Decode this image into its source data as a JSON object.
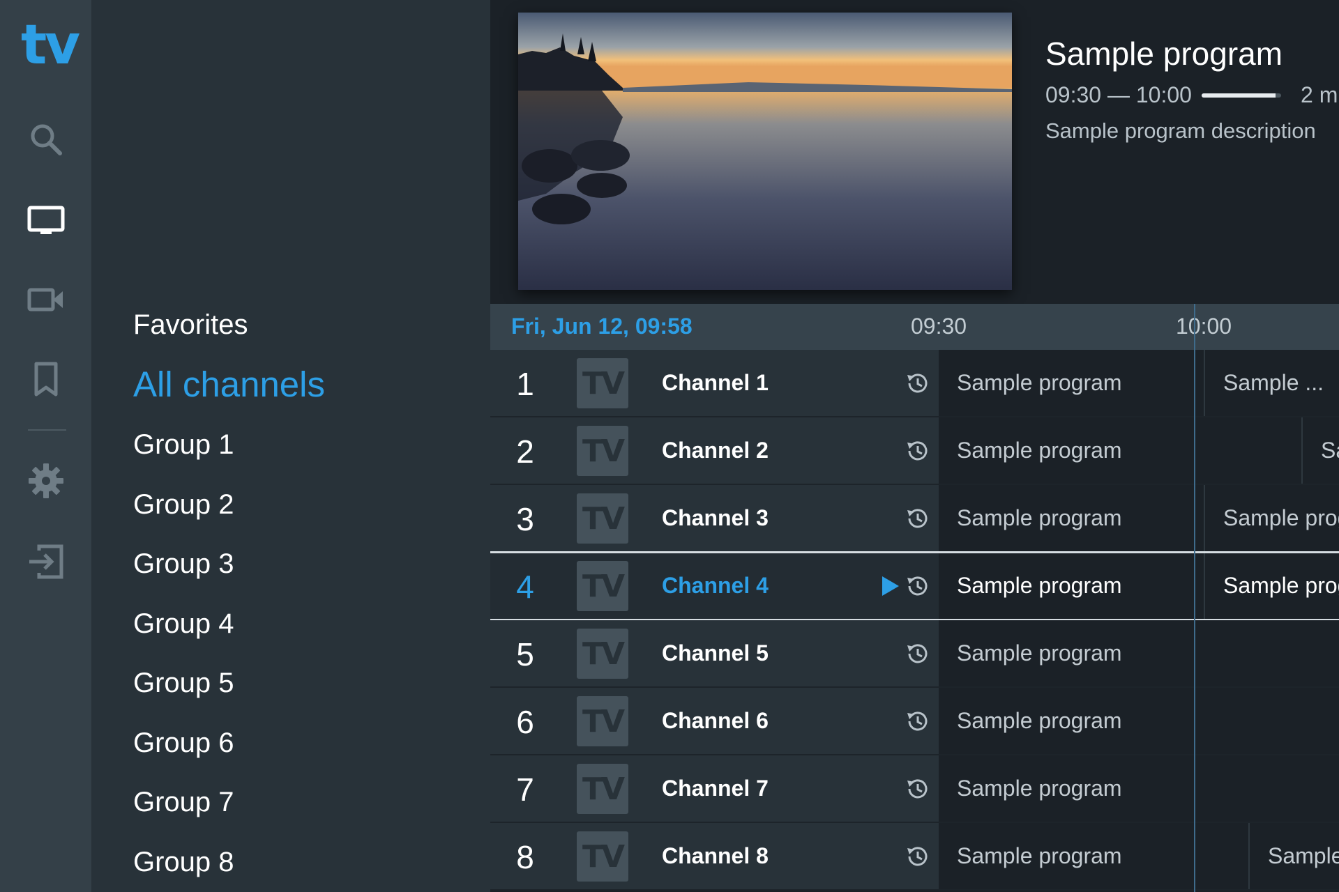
{
  "app": {
    "logo_text": "tv",
    "accent_color": "#2d9fe6"
  },
  "rail": {
    "icons": [
      "search-icon",
      "tv-icon",
      "video-camera-icon",
      "bookmark-icon",
      "settings-icon",
      "logout-icon"
    ]
  },
  "groups": {
    "items": [
      "Favorites",
      "All channels",
      "Group 1",
      "Group 2",
      "Group 3",
      "Group 4",
      "Group 5",
      "Group 6",
      "Group 7",
      "Group 8"
    ],
    "selected": "All channels"
  },
  "preview": {
    "title": "Sample program",
    "time_range": "09:30 — 10:00",
    "progress": 0.93,
    "remaining": "2 m",
    "description": "Sample program description"
  },
  "timeline": {
    "date": "Fri, Jun 12, 09:58",
    "ticks": [
      "09:30",
      "10:00"
    ]
  },
  "channels": [
    {
      "number": "1",
      "logo": "TV",
      "name": "Channel 1",
      "programs": [
        "Sample program",
        "Sample ..."
      ]
    },
    {
      "number": "2",
      "logo": "TV",
      "name": "Channel 2",
      "programs": [
        "Sample program",
        "Sa"
      ]
    },
    {
      "number": "3",
      "logo": "TV",
      "name": "Channel 3",
      "programs": [
        "Sample program",
        "Sample prog"
      ]
    },
    {
      "number": "4",
      "logo": "TV",
      "name": "Channel 4",
      "programs": [
        "Sample program",
        "Sample prog"
      ],
      "selected": true,
      "playing": true
    },
    {
      "number": "5",
      "logo": "TV",
      "name": "Channel 5",
      "programs": [
        "Sample program"
      ]
    },
    {
      "number": "6",
      "logo": "TV",
      "name": "Channel 6",
      "programs": [
        "Sample program"
      ]
    },
    {
      "number": "7",
      "logo": "TV",
      "name": "Channel 7",
      "programs": [
        "Sample program"
      ]
    },
    {
      "number": "8",
      "logo": "TV",
      "name": "Channel 8",
      "programs": [
        "Sample program",
        "Sample"
      ]
    }
  ]
}
